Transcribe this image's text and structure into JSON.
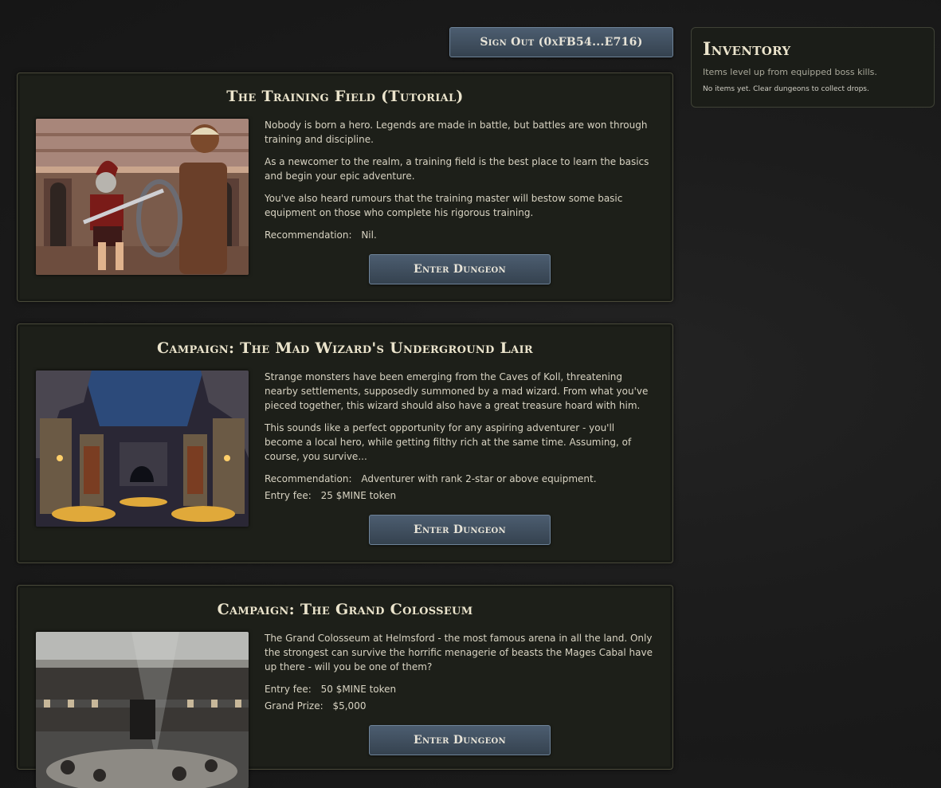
{
  "header": {
    "sign_out_label": "Sign Out (0xFB54...E716)"
  },
  "inventory": {
    "title": "Inventory",
    "subtitle": "Items level up from equipped boss kills.",
    "empty_text": "No items yet. Clear dungeons to collect drops."
  },
  "dungeons": [
    {
      "title": "The Training Field (Tutorial)",
      "paragraphs": [
        "Nobody is born a hero. Legends are made in battle, but battles are won through training and discipline.",
        "As a newcomer to the realm, a training field is the best place to learn the basics and begin your epic adventure.",
        "You've also heard rumours that the training master will bestow some basic equipment on those who complete his rigorous training."
      ],
      "recommendation_label": "Recommendation:",
      "recommendation_value": "Nil.",
      "button_label": "Enter Dungeon"
    },
    {
      "title": "Campaign: The Mad Wizard's Underground Lair",
      "paragraphs": [
        "Strange monsters have been emerging from the Caves of Koll, threatening nearby settlements, supposedly summoned by a mad wizard. From what you've pieced together, this wizard should also have a great treasure hoard with him.",
        "This sounds like a perfect opportunity for any aspiring adventurer - you'll become a local hero, while getting filthy rich at the same time. Assuming, of course, you survive..."
      ],
      "recommendation_label": "Recommendation:",
      "recommendation_value": "Adventurer with rank 2-star or above equipment.",
      "entry_fee_label": "Entry fee:",
      "entry_fee_value": "25 $MINE token",
      "button_label": "Enter Dungeon"
    },
    {
      "title": "Campaign: The Grand Colosseum",
      "paragraphs": [
        "The Grand Colosseum at Helmsford - the most famous arena in all the land. Only the strongest can survive the horrific menagerie of beasts the Mages Cabal have up there - will you be one of them?"
      ],
      "entry_fee_label": "Entry fee:",
      "entry_fee_value": "50 $MINE token",
      "grand_prize_label": "Grand Prize:",
      "grand_prize_value": "$5,000",
      "button_label": "Enter Dungeon"
    }
  ]
}
